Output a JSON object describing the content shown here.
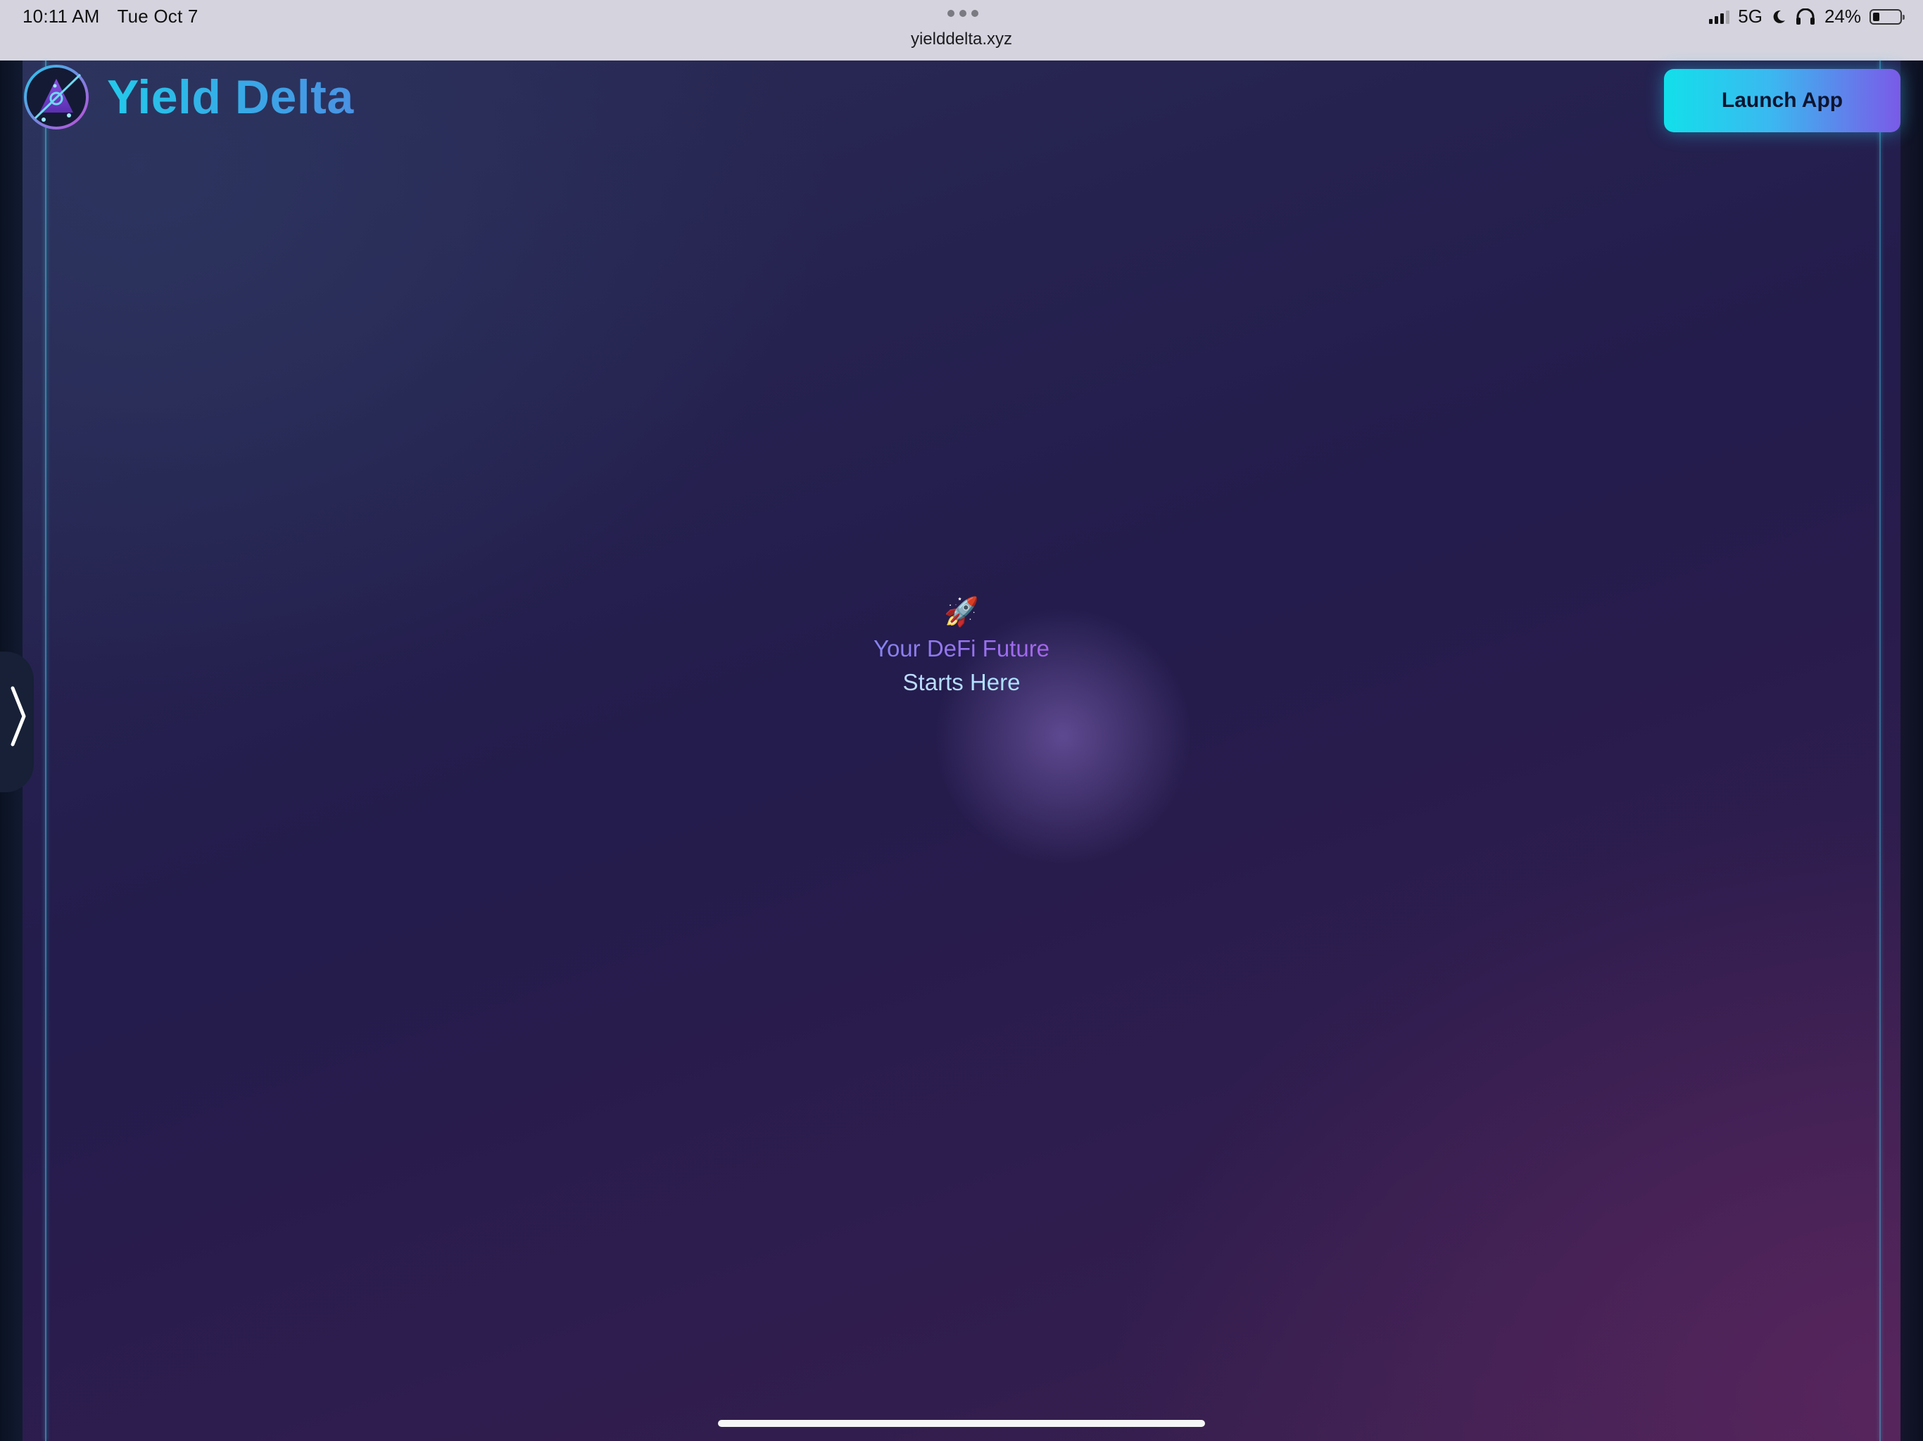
{
  "status_bar": {
    "time": "10:11 AM",
    "date": "Tue Oct 7",
    "url": "yielddelta.xyz",
    "network": "5G",
    "battery_percent": "24%",
    "battery_level": 0.24,
    "icons": [
      "signal-icon",
      "moon-icon",
      "headphones-icon",
      "battery-icon"
    ]
  },
  "header": {
    "brand_name": "Yield Delta",
    "launch_button_label": "Launch App"
  },
  "hero": {
    "emoji": "🚀",
    "line1": "Your DeFi Future",
    "line2": "Starts Here"
  },
  "colors": {
    "accent_cyan": "#23c9ea",
    "accent_purple": "#7a5ae8",
    "background_navy": "#231c4c",
    "background_plum": "#3c2150"
  }
}
